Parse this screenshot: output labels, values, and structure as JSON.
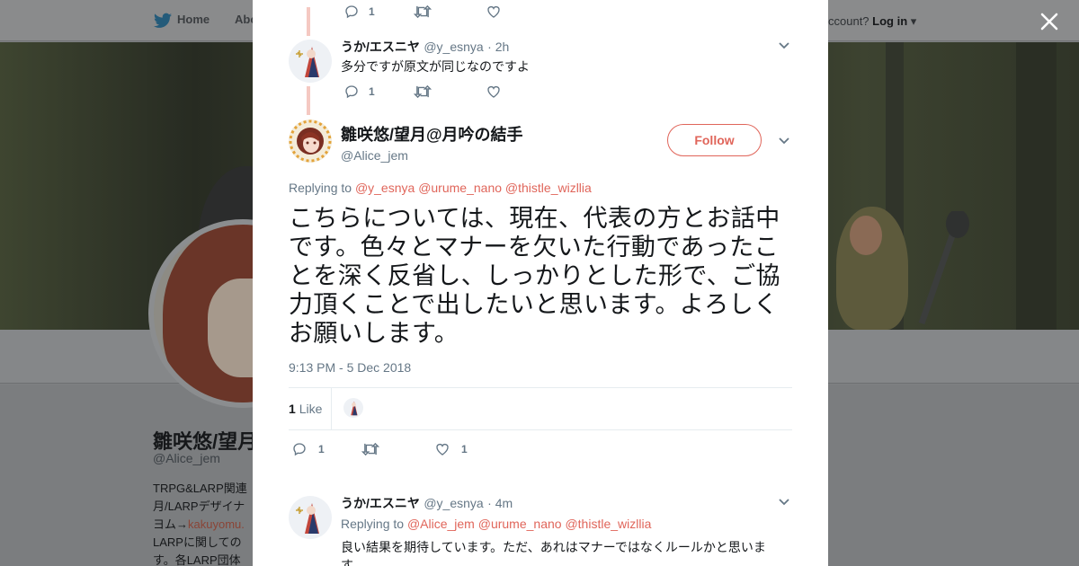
{
  "background": {
    "nav": {
      "home_label": "Home",
      "about_label": "Abo",
      "account_text": "ccount?",
      "login_label": "Log in"
    },
    "profile": {
      "name": "雛咲悠/望月",
      "handle": "@Alice_jem",
      "bio_lines": [
        "TRPG&LARP関連",
        "月/LARPデザイナ",
        "ヨム→",
        "LARPに関しての",
        "す。各LARP団体"
      ],
      "bio_link": "kakuyomu."
    }
  },
  "thread": {
    "prev_tweet": {
      "reply_count": "1"
    },
    "parent_tweet": {
      "name": "うか/エスニヤ",
      "handle": "@y_esnya",
      "time": "· 2h",
      "text": "多分ですが原文が同じなのですよ",
      "reply_count": "1"
    },
    "main_tweet": {
      "name": "雛咲悠/望月@月吟の結手",
      "handle": "@Alice_jem",
      "follow_label": "Follow",
      "replying_to_label": "Replying to",
      "mentions": [
        "@y_esnya",
        "@urume_nano",
        "@thistle_wizllia"
      ],
      "text": "こちらについては、現在、代表の方とお話中です。色々とマナーを欠いた行動であったことを深く反省し、しっかりとした形で、ご協力頂くことで出したいと思います。よろしくお願いします。",
      "timestamp": "9:13 PM - 5 Dec 2018",
      "like_count": "1",
      "like_label": "Like",
      "reply_count": "1",
      "likes_count_action": "1"
    },
    "reply_tweet": {
      "name": "うか/エスニヤ",
      "handle": "@y_esnya",
      "time": "· 4m",
      "replying_to_label": "Replying to",
      "mentions": [
        "@Alice_jem",
        "@urume_nano",
        "@thistle_wizllia"
      ],
      "text": "良い結果を期待しています。ただ、あれはマナーではなくルールかと思います。"
    }
  },
  "colors": {
    "accent": "#e0655a",
    "thread_line": "#f5c9c2",
    "muted": "#657786"
  },
  "icons": [
    "twitter-bird-icon",
    "close-icon",
    "reply-icon",
    "retweet-icon",
    "heart-icon",
    "chevron-down-icon"
  ]
}
